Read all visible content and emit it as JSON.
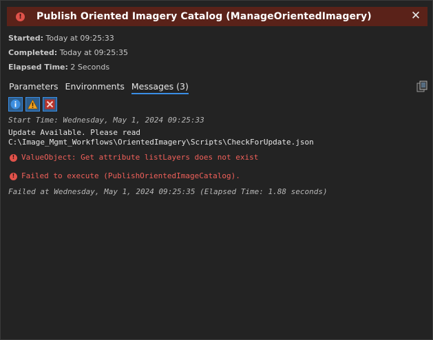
{
  "dialog": {
    "title": "Publish Oriented Imagery Catalog (ManageOrientedImagery)",
    "close_glyph": "✕",
    "status_color": "#e0524a"
  },
  "meta": {
    "started_label": "Started:",
    "started_value": "Today at 09:25:33",
    "completed_label": "Completed:",
    "completed_value": "Today at 09:25:35",
    "elapsed_label": "Elapsed Time:",
    "elapsed_value": "2 Seconds"
  },
  "tabs": [
    {
      "label": "Parameters"
    },
    {
      "label": "Environments"
    },
    {
      "label": "Messages (3)"
    }
  ],
  "filters": [
    "info-icon",
    "warning-icon",
    "error-icon"
  ],
  "messages": {
    "start": "Start Time: Wednesday, May 1, 2024 09:25:33",
    "update_line1": "Update Available. Please read",
    "update_line2": "C:\\Image_Mgmt_Workflows\\OrientedImagery\\Scripts\\CheckForUpdate.json",
    "error1": "ValueObject: Get attribute listLayers does not exist",
    "error2": "Failed to execute (PublishOrientedImageCatalog).",
    "failed": "Failed at Wednesday, May 1, 2024 09:25:35 (Elapsed Time: 1.88 seconds)"
  }
}
